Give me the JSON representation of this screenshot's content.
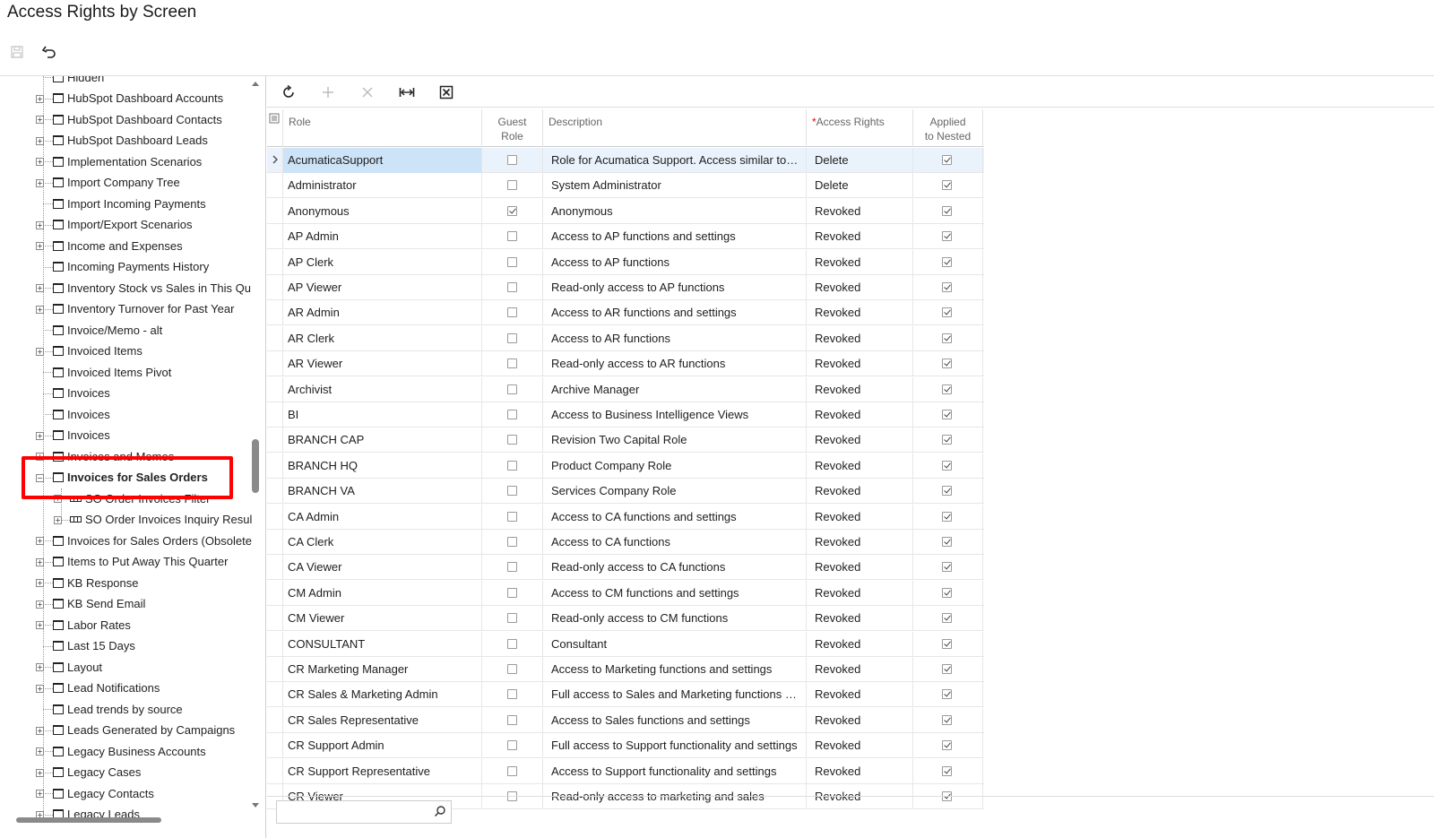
{
  "page": {
    "title": "Access Rights by Screen"
  },
  "tree": {
    "items": [
      {
        "label": "Hidden",
        "expander": false,
        "icon": "node"
      },
      {
        "label": "HubSpot Dashboard Accounts",
        "expander": true,
        "icon": "node"
      },
      {
        "label": "HubSpot Dashboard Contacts",
        "expander": true,
        "icon": "node"
      },
      {
        "label": "HubSpot Dashboard Leads",
        "expander": true,
        "icon": "node"
      },
      {
        "label": "Implementation Scenarios",
        "expander": true,
        "icon": "node"
      },
      {
        "label": "Import Company Tree",
        "expander": true,
        "icon": "node"
      },
      {
        "label": "Import Incoming Payments",
        "expander": false,
        "icon": "node"
      },
      {
        "label": "Import/Export Scenarios",
        "expander": true,
        "icon": "node"
      },
      {
        "label": "Income and Expenses",
        "expander": true,
        "icon": "node"
      },
      {
        "label": "Incoming Payments History",
        "expander": false,
        "icon": "node"
      },
      {
        "label": "Inventory Stock vs Sales in This Qu",
        "expander": true,
        "icon": "node"
      },
      {
        "label": "Inventory Turnover for Past Year",
        "expander": true,
        "icon": "node"
      },
      {
        "label": "Invoice/Memo - alt",
        "expander": false,
        "icon": "node"
      },
      {
        "label": "Invoiced Items",
        "expander": true,
        "icon": "node"
      },
      {
        "label": "Invoiced Items Pivot",
        "expander": false,
        "icon": "node"
      },
      {
        "label": "Invoices",
        "expander": false,
        "icon": "node"
      },
      {
        "label": "Invoices",
        "expander": false,
        "icon": "node"
      },
      {
        "label": "Invoices",
        "expander": true,
        "icon": "node"
      },
      {
        "label": "Invoices and Memos",
        "expander": true,
        "icon": "node"
      },
      {
        "label": "Invoices for Sales Orders",
        "expander": "open",
        "icon": "node",
        "bold": true
      },
      {
        "label": "SO Order Invoices Filter",
        "expander": true,
        "icon": "grid",
        "child": true
      },
      {
        "label": "SO Order Invoices Inquiry Resul",
        "expander": true,
        "icon": "grid",
        "child": true
      },
      {
        "label": "Invoices for Sales Orders (Obsolete",
        "expander": true,
        "icon": "node"
      },
      {
        "label": "Items to Put Away This Quarter",
        "expander": true,
        "icon": "node"
      },
      {
        "label": "KB Response",
        "expander": true,
        "icon": "node"
      },
      {
        "label": "KB Send Email",
        "expander": true,
        "icon": "node"
      },
      {
        "label": "Labor Rates",
        "expander": true,
        "icon": "node"
      },
      {
        "label": "Last 15 Days",
        "expander": false,
        "icon": "node"
      },
      {
        "label": "Layout",
        "expander": true,
        "icon": "node"
      },
      {
        "label": "Lead Notifications",
        "expander": true,
        "icon": "node"
      },
      {
        "label": "Lead trends by source",
        "expander": false,
        "icon": "node"
      },
      {
        "label": "Leads Generated by Campaigns",
        "expander": true,
        "icon": "node"
      },
      {
        "label": "Legacy Business Accounts",
        "expander": true,
        "icon": "node"
      },
      {
        "label": "Legacy Cases",
        "expander": true,
        "icon": "node"
      },
      {
        "label": "Legacy Contacts",
        "expander": true,
        "icon": "node"
      },
      {
        "label": "Legacy Leads",
        "expander": true,
        "icon": "node"
      }
    ]
  },
  "grid": {
    "columns": {
      "role": "Role",
      "guest_role": "Guest Role",
      "guest_role_line1": "Guest",
      "guest_role_line2": "Role",
      "description": "Description",
      "access_rights": "Access Rights",
      "applied_line1": "Applied",
      "applied_line2": "to Nested"
    },
    "rows": [
      {
        "role": "AcumaticaSupport",
        "guest": false,
        "description": "Role for Acumatica Support. Access similar to …",
        "rights": "Delete",
        "nested": true,
        "selected": true
      },
      {
        "role": "Administrator",
        "guest": false,
        "description": "System Administrator",
        "rights": "Delete",
        "nested": true
      },
      {
        "role": "Anonymous",
        "guest": true,
        "description": "Anonymous",
        "rights": "Revoked",
        "nested": true
      },
      {
        "role": "AP Admin",
        "guest": false,
        "description": "Access to AP functions and settings",
        "rights": "Revoked",
        "nested": true
      },
      {
        "role": "AP Clerk",
        "guest": false,
        "description": "Access to AP functions",
        "rights": "Revoked",
        "nested": true
      },
      {
        "role": "AP Viewer",
        "guest": false,
        "description": "Read-only access to AP functions",
        "rights": "Revoked",
        "nested": true
      },
      {
        "role": "AR Admin",
        "guest": false,
        "description": "Access to AR functions and settings",
        "rights": "Revoked",
        "nested": true
      },
      {
        "role": "AR Clerk",
        "guest": false,
        "description": "Access to AR functions",
        "rights": "Revoked",
        "nested": true
      },
      {
        "role": "AR Viewer",
        "guest": false,
        "description": "Read-only access to AR functions",
        "rights": "Revoked",
        "nested": true
      },
      {
        "role": "Archivist",
        "guest": false,
        "description": "Archive Manager",
        "rights": "Revoked",
        "nested": true
      },
      {
        "role": "BI",
        "guest": false,
        "description": "Access to Business Intelligence Views",
        "rights": "Revoked",
        "nested": true
      },
      {
        "role": "BRANCH CAP",
        "guest": false,
        "description": "Revision Two Capital Role",
        "rights": "Revoked",
        "nested": true
      },
      {
        "role": "BRANCH HQ",
        "guest": false,
        "description": "Product Company Role",
        "rights": "Revoked",
        "nested": true
      },
      {
        "role": "BRANCH VA",
        "guest": false,
        "description": "Services Company Role",
        "rights": "Revoked",
        "nested": true
      },
      {
        "role": "CA Admin",
        "guest": false,
        "description": "Access to CA functions and settings",
        "rights": "Revoked",
        "nested": true
      },
      {
        "role": "CA Clerk",
        "guest": false,
        "description": "Access to CA functions",
        "rights": "Revoked",
        "nested": true
      },
      {
        "role": "CA Viewer",
        "guest": false,
        "description": "Read-only access to CA functions",
        "rights": "Revoked",
        "nested": true
      },
      {
        "role": "CM Admin",
        "guest": false,
        "description": "Access to CM functions and settings",
        "rights": "Revoked",
        "nested": true
      },
      {
        "role": "CM Viewer",
        "guest": false,
        "description": "Read-only access to CM functions",
        "rights": "Revoked",
        "nested": true
      },
      {
        "role": "CONSULTANT",
        "guest": false,
        "description": "Consultant",
        "rights": "Revoked",
        "nested": true
      },
      {
        "role": "CR Marketing Manager",
        "guest": false,
        "description": "Access to Marketing functions and settings",
        "rights": "Revoked",
        "nested": true
      },
      {
        "role": "CR Sales & Marketing Admin",
        "guest": false,
        "description": "Full access to Sales and Marketing functions a…",
        "rights": "Revoked",
        "nested": true
      },
      {
        "role": "CR Sales Representative",
        "guest": false,
        "description": "Access to Sales functions and settings",
        "rights": "Revoked",
        "nested": true
      },
      {
        "role": "CR Support Admin",
        "guest": false,
        "description": "Full access to Support functionality and settings",
        "rights": "Revoked",
        "nested": true
      },
      {
        "role": "CR Support Representative",
        "guest": false,
        "description": "Access to Support functionality and settings",
        "rights": "Revoked",
        "nested": true
      },
      {
        "role": "CR Viewer",
        "guest": false,
        "description": "Read-only access to marketing and sales",
        "rights": "Revoked",
        "nested": true
      }
    ]
  },
  "search": {
    "placeholder": "",
    "value": ""
  },
  "icons": {
    "save": "save-icon",
    "undo": "undo-icon",
    "refresh": "refresh-icon",
    "add": "plus-icon",
    "delete": "close-icon",
    "fit": "fit-columns-icon",
    "export": "excel-export-icon",
    "search": "search-icon"
  },
  "colors": {
    "highlight": "#ff0000",
    "selected_row": "#eaf3fc",
    "selected_cell": "#cde3f7"
  }
}
